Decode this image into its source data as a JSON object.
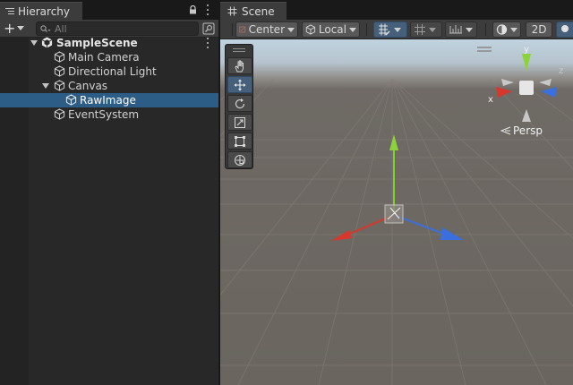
{
  "hierarchy": {
    "tab_label": "Hierarchy",
    "add_label": "+",
    "search_placeholder": "All",
    "items": [
      {
        "label": "SampleScene",
        "depth": 0,
        "expanded": true,
        "is_scene": true,
        "selected": false
      },
      {
        "label": "Main Camera",
        "depth": 1,
        "selected": false
      },
      {
        "label": "Directional Light",
        "depth": 1,
        "selected": false
      },
      {
        "label": "Canvas",
        "depth": 1,
        "expanded": true,
        "selected": false
      },
      {
        "label": "RawImage",
        "depth": 2,
        "selected": true
      },
      {
        "label": "EventSystem",
        "depth": 1,
        "selected": false
      }
    ]
  },
  "scene": {
    "tab_label": "Scene",
    "pivot_label": "Center",
    "space_label": "Local",
    "mode_2d_label": "2D",
    "persp_label": "Persp",
    "gizmo_axes": {
      "x": "x",
      "y": "y",
      "z": "z"
    },
    "tools": [
      "hand-tool",
      "move-tool",
      "rotate-tool",
      "scale-tool",
      "rect-tool",
      "transform-tool"
    ],
    "active_tool": "move-tool"
  },
  "colors": {
    "selection": "#2c5d87",
    "panel": "#282828",
    "toolbar": "#3c3c3c",
    "axis_x": "#d7382b",
    "axis_y": "#8cd23a",
    "axis_z": "#3a6fe0",
    "button_active": "#46607c"
  },
  "icons": {
    "hierarchy_tab": "list-icon",
    "scene_tab": "grid-icon",
    "lock": "lock-icon",
    "menu": "kebab-icon",
    "search": "search-icon",
    "gameobject": "cube-icon",
    "scene_asset": "unity-scene-icon"
  }
}
